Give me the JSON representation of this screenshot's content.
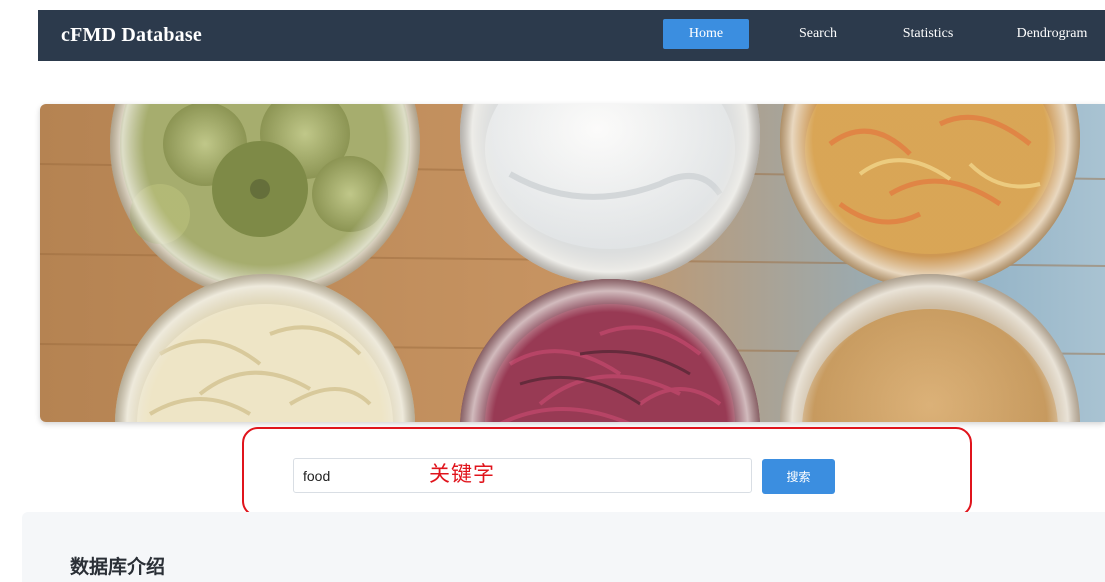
{
  "navbar": {
    "brand": "cFMD Database",
    "items": [
      {
        "label": "Home",
        "active": true
      },
      {
        "label": "Search",
        "active": false
      },
      {
        "label": "Statistics",
        "active": false
      },
      {
        "label": "Dendrogram",
        "active": false
      }
    ]
  },
  "search": {
    "value": "food",
    "annotation": "关键字",
    "button_label": "搜索"
  },
  "intro": {
    "title": "数据库介绍"
  },
  "colors": {
    "navbar_bg": "#2c3a4c",
    "accent_blue": "#3b8ee0",
    "highlight_red": "#e0141c",
    "panel_bg": "#f5f7f9"
  }
}
